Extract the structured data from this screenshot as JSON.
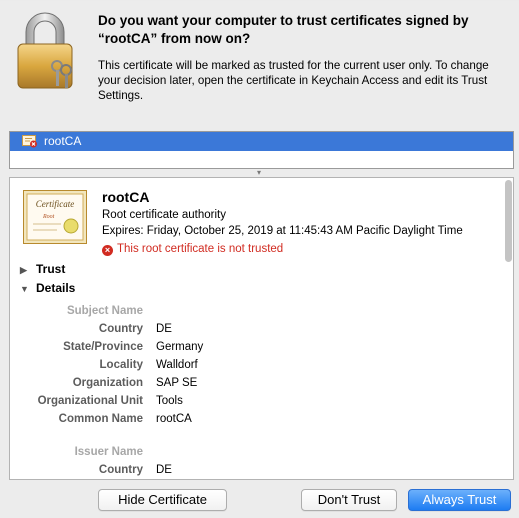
{
  "dialog": {
    "title": "Do you want your computer to trust certificates signed by “rootCA” from now on?",
    "message": "This certificate will be marked as trusted for the current user only. To change your decision later, open the certificate in Keychain Access and edit its Trust Settings."
  },
  "certificate_list": {
    "items": [
      {
        "label": "rootCA",
        "selected": true,
        "icon": "certificate-invalid-icon"
      }
    ]
  },
  "details": {
    "name": "rootCA",
    "type": "Root certificate authority",
    "expires": "Expires: Friday, October 25, 2019 at 11:45:43 AM Pacific Daylight Time",
    "warning": "This root certificate is not trusted",
    "trust_label": "Trust",
    "details_label": "Details",
    "subject": {
      "section": "Subject Name",
      "fields": [
        {
          "label": "Country",
          "value": "DE"
        },
        {
          "label": "State/Province",
          "value": "Germany"
        },
        {
          "label": "Locality",
          "value": "Walldorf"
        },
        {
          "label": "Organization",
          "value": "SAP SE"
        },
        {
          "label": "Organizational Unit",
          "value": "Tools"
        },
        {
          "label": "Common Name",
          "value": "rootCA"
        }
      ]
    },
    "issuer": {
      "section": "Issuer Name",
      "fields": [
        {
          "label": "Country",
          "value": "DE"
        }
      ]
    }
  },
  "buttons": {
    "hide_certificate": "Hide Certificate",
    "dont_trust": "Don't Trust",
    "always_trust": "Always Trust"
  },
  "colors": {
    "selection": "#3b78d8",
    "warning": "#d12b21",
    "default_button": "#1d7cf2"
  }
}
